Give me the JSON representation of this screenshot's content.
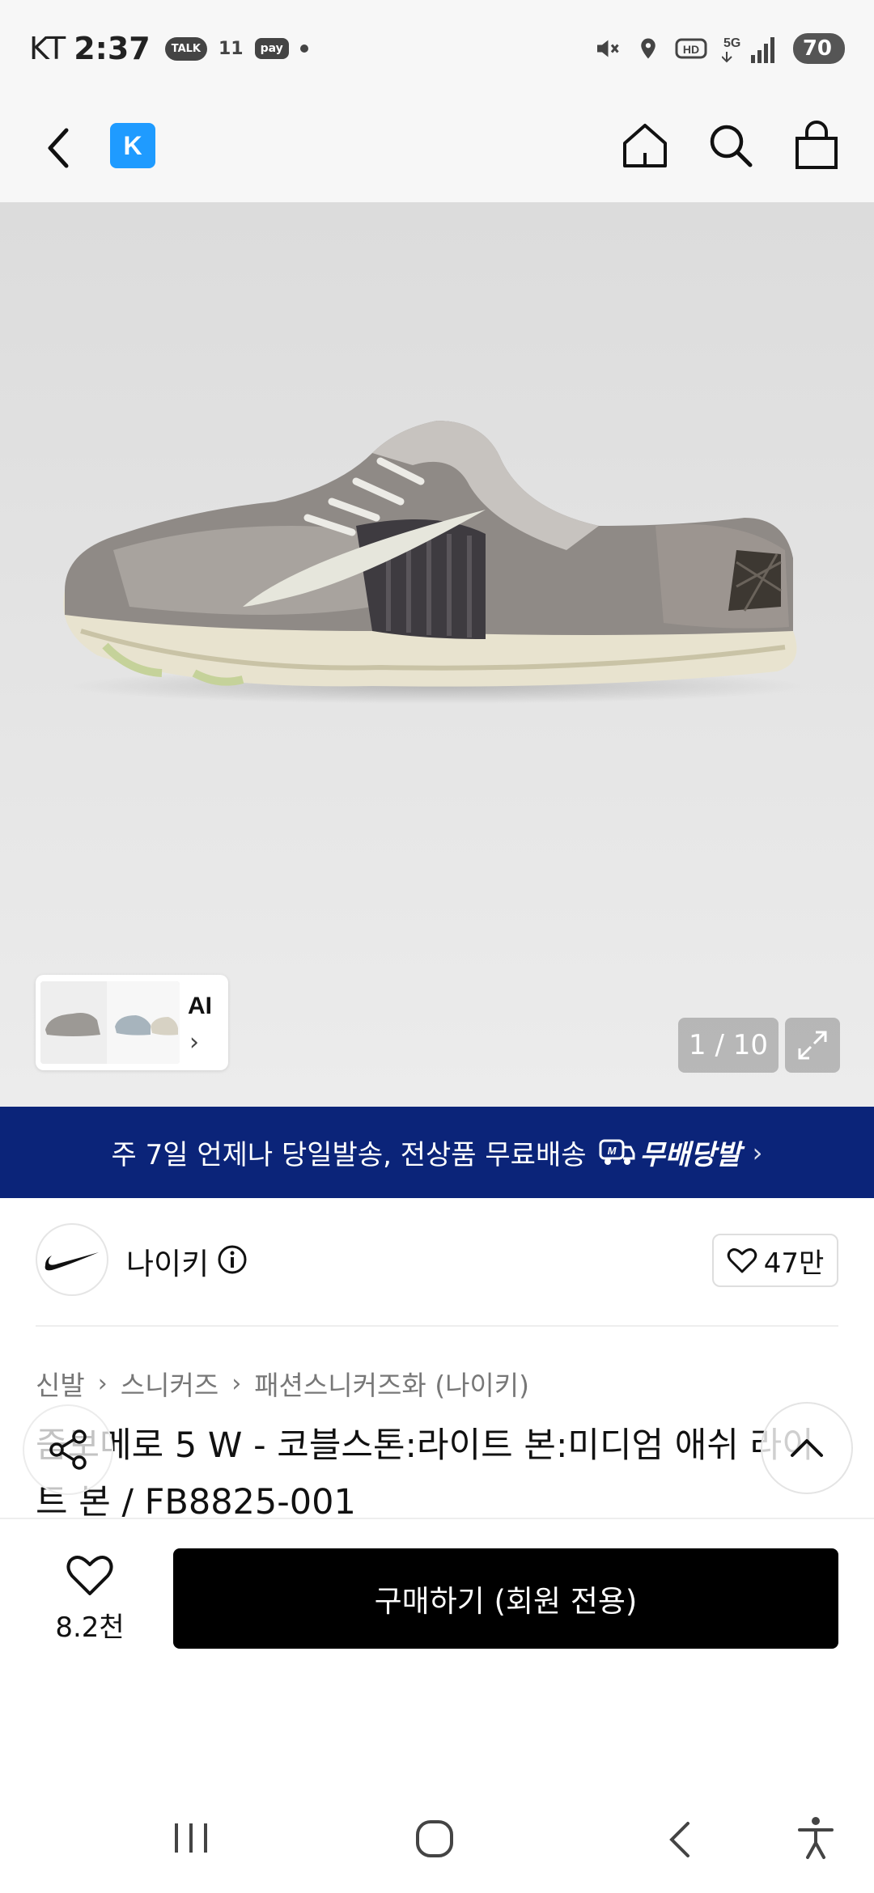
{
  "status_bar": {
    "carrier": "KT",
    "time": "2:37",
    "talk_badge": "TALK",
    "eleven_label": "11",
    "pay_badge": "pay",
    "battery": "70"
  },
  "header": {
    "logo_letter": "K"
  },
  "gallery": {
    "thumb_label": "AI",
    "pager": "1 / 10"
  },
  "promo": {
    "text": "주 7일 언제나 당일발송, 전상품 무료배송",
    "badge": "무배당발"
  },
  "brand": {
    "name": "나이키",
    "favorite_count": "47만"
  },
  "breadcrumb": [
    "신발",
    "스니커즈",
    "패션스니커즈화 (나이키)"
  ],
  "product": {
    "title": "줌보메로 5 W - 코블스톤:라이트 본:미디엄 애쉬 라이트 본 / FB8825-001"
  },
  "bottom": {
    "wish_count": "8.2천",
    "buy_label": "구매하기 (회원 전용)"
  },
  "colors": {
    "promo_bg": "#0b2479",
    "logo_blue": "#1f9bff",
    "buy_bg": "#000000"
  }
}
